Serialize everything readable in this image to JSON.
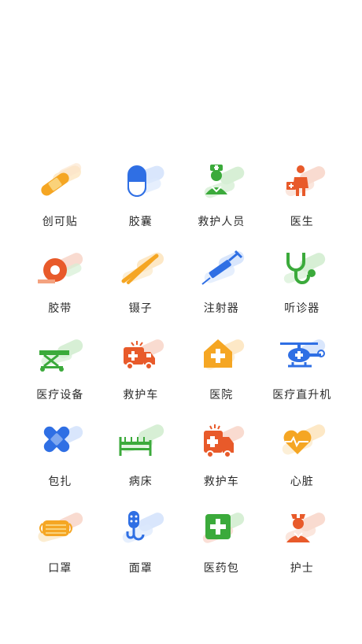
{
  "icons": [
    {
      "label": "创可贴",
      "icon": "bandage-icon",
      "color": "#F5A623"
    },
    {
      "label": "胶囊",
      "icon": "capsule-icon",
      "color": "#2F6FE4"
    },
    {
      "label": "救护人员",
      "icon": "medic-icon",
      "color": "#3BAA3B"
    },
    {
      "label": "医生",
      "icon": "doctor-icon",
      "color": "#E85A2A"
    },
    {
      "label": "胶带",
      "icon": "tape-icon",
      "color": "#E85A2A"
    },
    {
      "label": "镊子",
      "icon": "tweezers-icon",
      "color": "#F5A623"
    },
    {
      "label": "注射器",
      "icon": "syringe-icon",
      "color": "#2F6FE4"
    },
    {
      "label": "听诊器",
      "icon": "stethoscope-icon",
      "color": "#3BAA3B"
    },
    {
      "label": "医疗设备",
      "icon": "stretcher-icon",
      "color": "#3BAA3B"
    },
    {
      "label": "救护车",
      "icon": "ambulance-icon",
      "color": "#E85A2A"
    },
    {
      "label": "医院",
      "icon": "hospital-icon",
      "color": "#F5A623"
    },
    {
      "label": "医疗直升机",
      "icon": "helicopter-icon",
      "color": "#2F6FE4"
    },
    {
      "label": "包扎",
      "icon": "bandage-cross-icon",
      "color": "#2F6FE4"
    },
    {
      "label": "病床",
      "icon": "hospital-bed-icon",
      "color": "#3BAA3B"
    },
    {
      "label": "救护车",
      "icon": "ambulance-truck-icon",
      "color": "#E85A2A"
    },
    {
      "label": "心脏",
      "icon": "heart-icon",
      "color": "#F5A623"
    },
    {
      "label": "口罩",
      "icon": "mask-icon",
      "color": "#F5A623"
    },
    {
      "label": "面罩",
      "icon": "face-mask-icon",
      "color": "#2F6FE4"
    },
    {
      "label": "医药包",
      "icon": "medkit-icon",
      "color": "#3BAA3B"
    },
    {
      "label": "护士",
      "icon": "nurse-icon",
      "color": "#E85A2A"
    }
  ]
}
